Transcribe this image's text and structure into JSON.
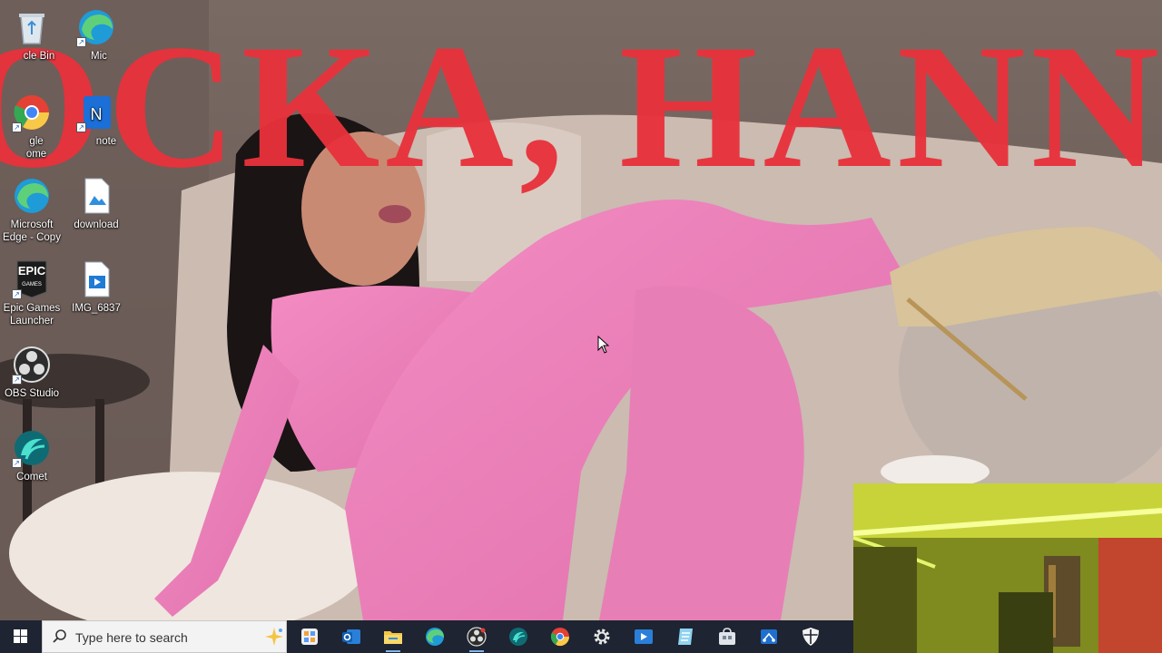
{
  "wallpaper": {
    "headline": "OCKA, HANNA",
    "headline_color": "#e8323c"
  },
  "desktop": {
    "icons": [
      {
        "name": "recycle-bin",
        "label": "Recycle Bin",
        "label_visible": "cle Bin"
      },
      {
        "name": "microsoft-edge",
        "label": "Microsoft",
        "label_visible": "Mic"
      },
      {
        "name": "google-chrome",
        "label": "Google Chrome",
        "label_line1": "gle",
        "label_line2": "ome"
      },
      {
        "name": "onenote",
        "label": "OneNote",
        "label_visible": "note"
      },
      {
        "name": "microsoft-edge-copy",
        "label_line1": "Microsoft",
        "label_line2": "Edge - Copy"
      },
      {
        "name": "download",
        "label": "download"
      },
      {
        "name": "epic-games-launcher",
        "label_line1": "Epic Games",
        "label_line2": "Launcher",
        "glyph_text": "EPIC",
        "glyph_sub": "GAMES"
      },
      {
        "name": "img-6837",
        "label": "IMG_6837"
      },
      {
        "name": "obs-studio",
        "label": "OBS Studio"
      },
      {
        "name": "comet",
        "label": "Comet"
      }
    ]
  },
  "taskbar": {
    "search_placeholder": "Type here to search",
    "apps": [
      "widgets-icon",
      "outlook-icon",
      "file-explorer-icon",
      "edge-icon",
      "obs-icon",
      "comet-icon",
      "chrome-icon",
      "settings-icon",
      "video-player-icon",
      "notepad-icon",
      "store-icon",
      "snipping-icon",
      "security-icon"
    ],
    "colors": {
      "bar": "#1e2431",
      "accent": "#7fb6ee"
    }
  }
}
